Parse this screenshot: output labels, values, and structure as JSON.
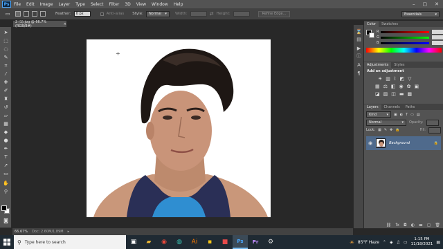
{
  "app": {
    "logo": "Ps",
    "menu": [
      "File",
      "Edit",
      "Image",
      "Layer",
      "Type",
      "Select",
      "Filter",
      "3D",
      "View",
      "Window",
      "Help"
    ],
    "window_controls": [
      "–",
      "▢",
      "✕"
    ]
  },
  "options": {
    "feather_label": "Feather:",
    "feather_value": "0 px",
    "antialias_label": "Anti-alias",
    "style_label": "Style:",
    "style_value": "Normal",
    "width_label": "Width:",
    "height_label": "Height:",
    "refine_label": "Refine Edge..."
  },
  "workspace_switcher": "Essentials",
  "document": {
    "tab_title": "2 (1).jpg @ 66.7% (RGB/8#)",
    "zoom": "66.67%",
    "doc_info": "Doc: 2.60M/1.89M"
  },
  "panels": {
    "color_tabs": [
      "Color",
      "Swatches"
    ],
    "sliders": [
      {
        "label": "R",
        "value": ""
      },
      {
        "label": "G",
        "value": ""
      },
      {
        "label": "B",
        "value": ""
      }
    ],
    "adjust_tabs": [
      "Adjustments",
      "Styles"
    ],
    "adjust_title": "Add an adjustment",
    "layers_tabs": [
      "Layers",
      "Channels",
      "Paths"
    ],
    "kind_label": "Kind",
    "blend_mode": "Normal",
    "opacity_label": "Opacity:",
    "lock_label": "Lock:",
    "fill_label": "Fill:",
    "layer_name": "Background"
  },
  "taskbar": {
    "search_placeholder": "Type here to search",
    "weather": "85°F  Haze",
    "time": "1:15 PM",
    "date": "11/18/2021"
  },
  "colors": {
    "accent": "#4aa8ff",
    "panel": "#535353",
    "canvas_bg": "#282828",
    "selected_layer": "#4f6a8c"
  }
}
